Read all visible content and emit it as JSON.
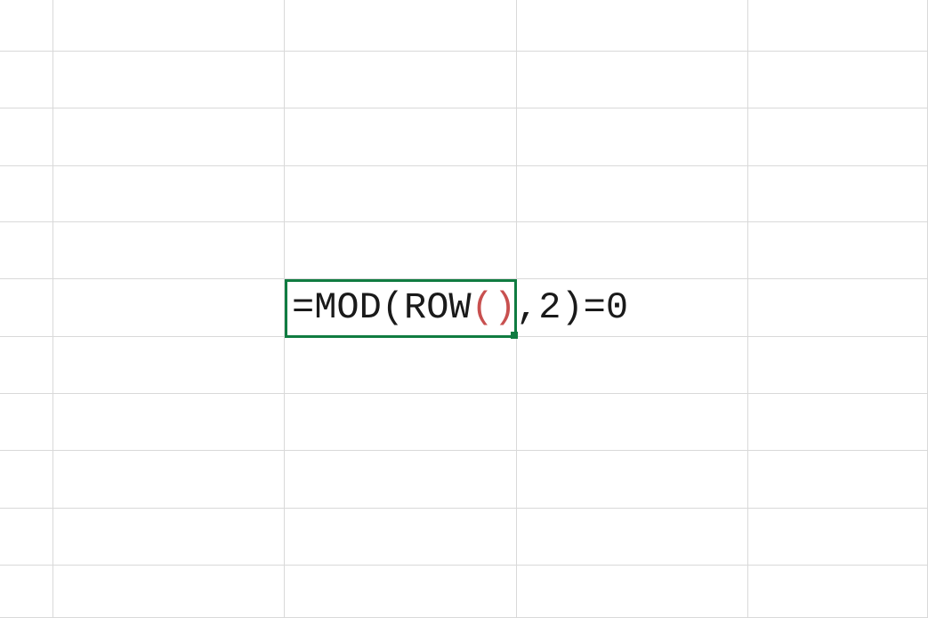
{
  "grid": {
    "col_boundaries": [
      0,
      60,
      320,
      581,
      841,
      1043
    ],
    "row_boundaries": [
      0,
      58,
      122,
      187,
      250,
      314,
      379,
      443,
      507,
      572,
      636,
      695
    ],
    "active_cell": {
      "col_index": 2,
      "row_index": 5
    }
  },
  "formula": {
    "part1": "=MOD(ROW",
    "part2_paren": "()",
    "part3": ",2)=0",
    "full": "=MOD(ROW(),2)=0"
  }
}
